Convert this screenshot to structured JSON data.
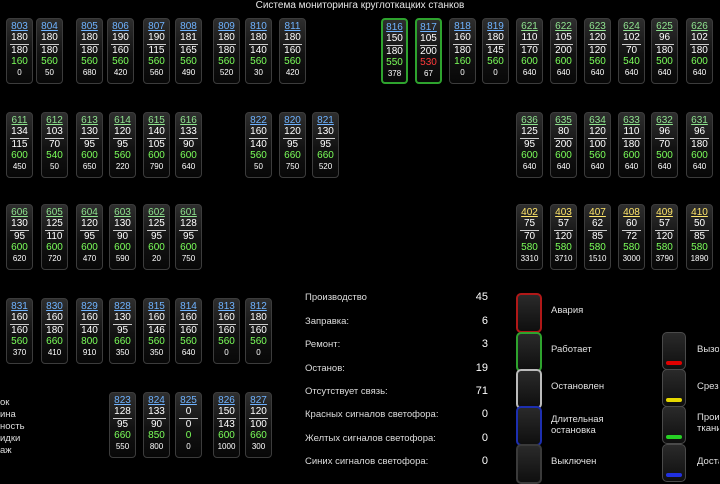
{
  "header": {
    "title": "Система мониторинга круглоткацких станков"
  },
  "colors": {
    "active_border": "#2ea32e",
    "ok_value": "#7bff5a",
    "alarm_value": "#ff3a3a",
    "alarm_border": "#b01818",
    "stopped_border": "#bbbbbb",
    "long_stop_border": "#1d2fb0",
    "red_light": "#e00000",
    "yellow_light": "#e6d800",
    "green_light": "#26d024",
    "blue_light": "#2030e0"
  },
  "machines": [
    {
      "id": "803",
      "v": [
        "180",
        "180",
        "160",
        "0"
      ],
      "color": "blue",
      "status": "normal"
    },
    {
      "id": "804",
      "v": [
        "180",
        "180",
        "560",
        "50"
      ],
      "color": "blue",
      "status": "normal"
    },
    {
      "id": "805",
      "v": [
        "180",
        "180",
        "560",
        "680"
      ],
      "color": "blue",
      "status": "normal"
    },
    {
      "id": "806",
      "v": [
        "190",
        "160",
        "560",
        "420"
      ],
      "color": "blue",
      "status": "normal"
    },
    {
      "id": "807",
      "v": [
        "190",
        "115",
        "560",
        "560"
      ],
      "color": "blue",
      "status": "normal"
    },
    {
      "id": "808",
      "v": [
        "181",
        "165",
        "560",
        "490"
      ],
      "color": "blue",
      "status": "normal"
    },
    {
      "id": "809",
      "v": [
        "180",
        "180",
        "560",
        "520"
      ],
      "color": "blue",
      "status": "normal"
    },
    {
      "id": "810",
      "v": [
        "180",
        "140",
        "560",
        "30"
      ],
      "color": "blue",
      "status": "normal"
    },
    {
      "id": "811",
      "v": [
        "180",
        "160",
        "560",
        "420"
      ],
      "color": "blue",
      "status": "normal"
    },
    {
      "id": "816",
      "v": [
        "150",
        "180",
        "550",
        "378"
      ],
      "color": "blue",
      "status": "working"
    },
    {
      "id": "817",
      "v": [
        "105",
        "200",
        "530",
        "67"
      ],
      "color": "blue",
      "status": "working",
      "v4red": true
    },
    {
      "id": "818",
      "v": [
        "160",
        "180",
        "160",
        "0"
      ],
      "color": "blue",
      "status": "normal"
    },
    {
      "id": "819",
      "v": [
        "180",
        "145",
        "560",
        "0"
      ],
      "color": "blue",
      "status": "normal"
    },
    {
      "id": "621",
      "v": [
        "110",
        "170",
        "600",
        "640"
      ],
      "color": "green",
      "status": "normal"
    },
    {
      "id": "622",
      "v": [
        "105",
        "200",
        "600",
        "640"
      ],
      "color": "green",
      "status": "normal"
    },
    {
      "id": "623",
      "v": [
        "120",
        "120",
        "560",
        "640"
      ],
      "color": "green",
      "status": "normal"
    },
    {
      "id": "624",
      "v": [
        "102",
        "70",
        "540",
        "640"
      ],
      "color": "green",
      "status": "normal"
    },
    {
      "id": "625",
      "v": [
        "96",
        "180",
        "500",
        "640"
      ],
      "color": "green",
      "status": "normal"
    },
    {
      "id": "626",
      "v": [
        "102",
        "180",
        "600",
        "640"
      ],
      "color": "green",
      "status": "normal"
    },
    {
      "id": "611",
      "v": [
        "134",
        "115",
        "600",
        "450"
      ],
      "color": "green",
      "status": "normal"
    },
    {
      "id": "612",
      "v": [
        "103",
        "70",
        "540",
        "50"
      ],
      "color": "green",
      "status": "normal"
    },
    {
      "id": "613",
      "v": [
        "130",
        "95",
        "600",
        "650"
      ],
      "color": "green",
      "status": "normal"
    },
    {
      "id": "614",
      "v": [
        "120",
        "95",
        "560",
        "220"
      ],
      "color": "green",
      "status": "normal"
    },
    {
      "id": "615",
      "v": [
        "140",
        "105",
        "600",
        "790"
      ],
      "color": "green",
      "status": "normal"
    },
    {
      "id": "616",
      "v": [
        "133",
        "90",
        "600",
        "640"
      ],
      "color": "green",
      "status": "normal"
    },
    {
      "id": "822",
      "v": [
        "160",
        "140",
        "560",
        "50"
      ],
      "color": "blue",
      "status": "normal"
    },
    {
      "id": "820",
      "v": [
        "120",
        "95",
        "660",
        "750"
      ],
      "color": "blue",
      "status": "normal"
    },
    {
      "id": "821",
      "v": [
        "130",
        "95",
        "660",
        "520"
      ],
      "color": "blue",
      "status": "normal"
    },
    {
      "id": "636",
      "v": [
        "125",
        "95",
        "600",
        "640"
      ],
      "color": "green",
      "status": "normal"
    },
    {
      "id": "635",
      "v": [
        "80",
        "200",
        "600",
        "640"
      ],
      "color": "green",
      "status": "normal"
    },
    {
      "id": "634",
      "v": [
        "120",
        "100",
        "560",
        "640"
      ],
      "color": "green",
      "status": "normal"
    },
    {
      "id": "633",
      "v": [
        "110",
        "180",
        "600",
        "640"
      ],
      "color": "green",
      "status": "normal"
    },
    {
      "id": "632",
      "v": [
        "96",
        "70",
        "500",
        "640"
      ],
      "color": "green",
      "status": "normal"
    },
    {
      "id": "631",
      "v": [
        "96",
        "180",
        "600",
        "640"
      ],
      "color": "green",
      "status": "normal"
    },
    {
      "id": "606",
      "v": [
        "130",
        "95",
        "600",
        "620"
      ],
      "color": "green",
      "status": "normal"
    },
    {
      "id": "605",
      "v": [
        "125",
        "110",
        "600",
        "720"
      ],
      "color": "green",
      "status": "normal"
    },
    {
      "id": "604",
      "v": [
        "120",
        "95",
        "600",
        "470"
      ],
      "color": "green",
      "status": "normal"
    },
    {
      "id": "603",
      "v": [
        "130",
        "90",
        "600",
        "590"
      ],
      "color": "green",
      "status": "normal"
    },
    {
      "id": "602",
      "v": [
        "125",
        "95",
        "600",
        "20"
      ],
      "color": "green",
      "status": "normal"
    },
    {
      "id": "601",
      "v": [
        "128",
        "95",
        "600",
        "750"
      ],
      "color": "green",
      "status": "normal"
    },
    {
      "id": "402",
      "v": [
        "75",
        "70",
        "580",
        "3310"
      ],
      "color": "yellow",
      "status": "normal"
    },
    {
      "id": "403",
      "v": [
        "57",
        "120",
        "580",
        "3710"
      ],
      "color": "yellow",
      "status": "normal"
    },
    {
      "id": "407",
      "v": [
        "62",
        "85",
        "580",
        "1510"
      ],
      "color": "yellow",
      "status": "normal"
    },
    {
      "id": "408",
      "v": [
        "60",
        "72",
        "580",
        "3000"
      ],
      "color": "yellow",
      "status": "normal"
    },
    {
      "id": "409",
      "v": [
        "57",
        "120",
        "580",
        "3790"
      ],
      "color": "yellow",
      "status": "normal"
    },
    {
      "id": "410",
      "v": [
        "50",
        "85",
        "580",
        "1890"
      ],
      "color": "yellow",
      "status": "normal"
    },
    {
      "id": "831",
      "v": [
        "160",
        "160",
        "560",
        "370"
      ],
      "color": "blue",
      "status": "normal"
    },
    {
      "id": "830",
      "v": [
        "160",
        "180",
        "660",
        "410"
      ],
      "color": "blue",
      "status": "normal"
    },
    {
      "id": "829",
      "v": [
        "160",
        "140",
        "800",
        "910"
      ],
      "color": "blue",
      "status": "normal"
    },
    {
      "id": "828",
      "v": [
        "130",
        "95",
        "660",
        "350"
      ],
      "color": "blue",
      "status": "normal"
    },
    {
      "id": "815",
      "v": [
        "160",
        "146",
        "560",
        "350"
      ],
      "color": "blue",
      "status": "normal"
    },
    {
      "id": "814",
      "v": [
        "160",
        "160",
        "560",
        "640"
      ],
      "color": "blue",
      "status": "normal"
    },
    {
      "id": "813",
      "v": [
        "160",
        "160",
        "560",
        "0"
      ],
      "color": "blue",
      "status": "normal"
    },
    {
      "id": "812",
      "v": [
        "180",
        "160",
        "560",
        "0"
      ],
      "color": "blue",
      "status": "normal"
    },
    {
      "id": "823",
      "v": [
        "128",
        "95",
        "660",
        "550"
      ],
      "color": "blue",
      "status": "normal"
    },
    {
      "id": "824",
      "v": [
        "133",
        "90",
        "850",
        "800"
      ],
      "color": "blue",
      "status": "normal"
    },
    {
      "id": "825",
      "v": [
        "0",
        "0",
        "0",
        "0"
      ],
      "color": "blue",
      "status": "normal"
    },
    {
      "id": "826",
      "v": [
        "150",
        "143",
        "600",
        "1000"
      ],
      "color": "blue",
      "status": "normal"
    },
    {
      "id": "827",
      "v": [
        "120",
        "100",
        "660",
        "300"
      ],
      "color": "blue",
      "status": "normal"
    }
  ],
  "stats": [
    {
      "label": "Производство",
      "value": "45"
    },
    {
      "label": "Заправка:",
      "value": "6"
    },
    {
      "label": "Ремонт:",
      "value": "3"
    },
    {
      "label": "Останов:",
      "value": "19"
    },
    {
      "label": "Отсутствует связь:",
      "value": "71"
    },
    {
      "label": "Красных сигналов светофора:",
      "value": "0"
    },
    {
      "label": "Желтых сигналов светофора:",
      "value": "0"
    },
    {
      "label": "Синих сигналов светофора:",
      "value": "0"
    }
  ],
  "legend": [
    {
      "label": "Авария",
      "border": "#b01818"
    },
    {
      "label": "Работает",
      "border": "#2ea32e"
    },
    {
      "label": "Остановлен",
      "border": "#bbbbbb"
    },
    {
      "label": "Длительная остановка",
      "border": "#1d2fb0"
    },
    {
      "label": "Выключен",
      "border": "#3a3a3a"
    }
  ],
  "lights": [
    {
      "label": "Вызо",
      "color": "#e00000"
    },
    {
      "label": "Срезк",
      "color": "#e6d800"
    },
    {
      "label": "Произ ткани",
      "color": "#26d024"
    },
    {
      "label": "Доста",
      "color": "#2030e0"
    }
  ],
  "left_cut": [
    "ок",
    "ина",
    "ность",
    "идки",
    "аж"
  ]
}
